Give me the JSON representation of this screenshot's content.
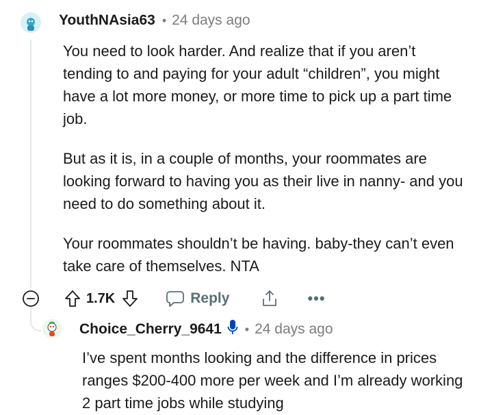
{
  "comment": {
    "author": "YouthNAsia63",
    "separator": "•",
    "time": "24 days ago",
    "paragraphs": [
      "You need to look harder. And realize that if you aren’t tending to and paying for your adult “children”, you might have a lot more money, or more time to pick up a part time job.",
      "But as it is, in a couple of months, your roommates are looking forward to having you as their live in nanny- and you need to do something about it.",
      "Your roommates shouldn’t be having. baby-they can’t even take care of themselves. NTA"
    ],
    "actions": {
      "vote_count": "1.7K",
      "reply_label": "Reply",
      "more_label": "•••"
    }
  },
  "reply": {
    "author": "Choice_Cherry_9641",
    "separator": "•",
    "time": "24 days ago",
    "text": "I’ve spent months looking and the difference in prices ranges $200-400 more per week and I’m already working 2 part time jobs while studying"
  },
  "colors": {
    "meta_gray": "#7c7c7c",
    "action_gray": "#576f76",
    "thread_line": "#e4e6e8",
    "mic_blue": "#0045ac"
  },
  "icons": [
    "collapse-icon",
    "upvote-icon",
    "downvote-icon",
    "reply-icon",
    "share-icon",
    "more-icon",
    "microphone-icon"
  ]
}
